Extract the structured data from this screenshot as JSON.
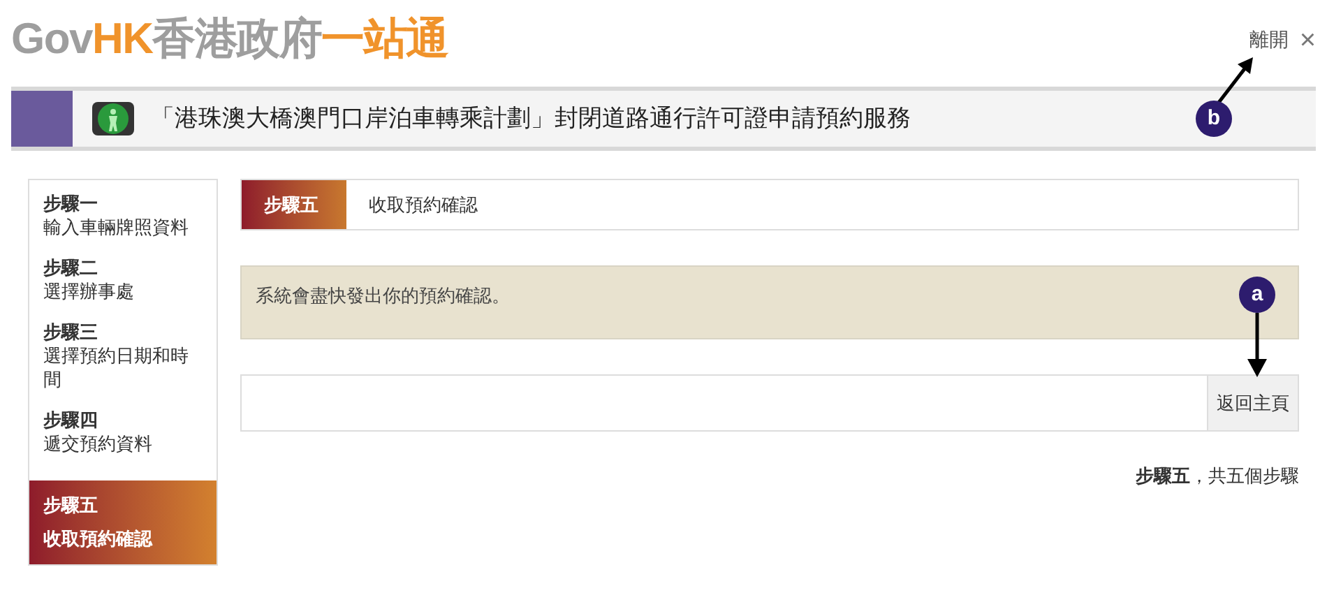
{
  "logo": {
    "parts": [
      {
        "text": "Gov",
        "color": "#9e9e9e"
      },
      {
        "text": "HK",
        "color": "#f0932b"
      },
      {
        "text": "香港政府",
        "color": "#9e9e9e"
      },
      {
        "text": "一站通",
        "color": "#f0932b"
      }
    ]
  },
  "exit_link": {
    "label": "離開",
    "close": "×"
  },
  "header": {
    "title": "「港珠澳大橋澳門口岸泊車轉乘計劃」封閉道路通行許可證申請預約服務"
  },
  "steps": [
    {
      "label": "步驟一",
      "title": "輸入車輛牌照資料",
      "selected": false
    },
    {
      "label": "步驟二",
      "title": "選擇辦事處",
      "selected": false
    },
    {
      "label": "步驟三",
      "title": "選擇預約日期和時間",
      "selected": false
    },
    {
      "label": "步驟四",
      "title": "遞交預約資料",
      "selected": false
    },
    {
      "label": "步驟五",
      "title": "收取預約確認",
      "selected": true
    }
  ],
  "current_step": {
    "label": "步驟五",
    "title": "收取預約確認"
  },
  "message": "系統會盡快發出你的預約確認。",
  "home_button": "返回主頁",
  "progress": "**步驟五**，共五個步驟",
  "annotations": [
    {
      "letter": "a"
    },
    {
      "letter": "b"
    }
  ]
}
